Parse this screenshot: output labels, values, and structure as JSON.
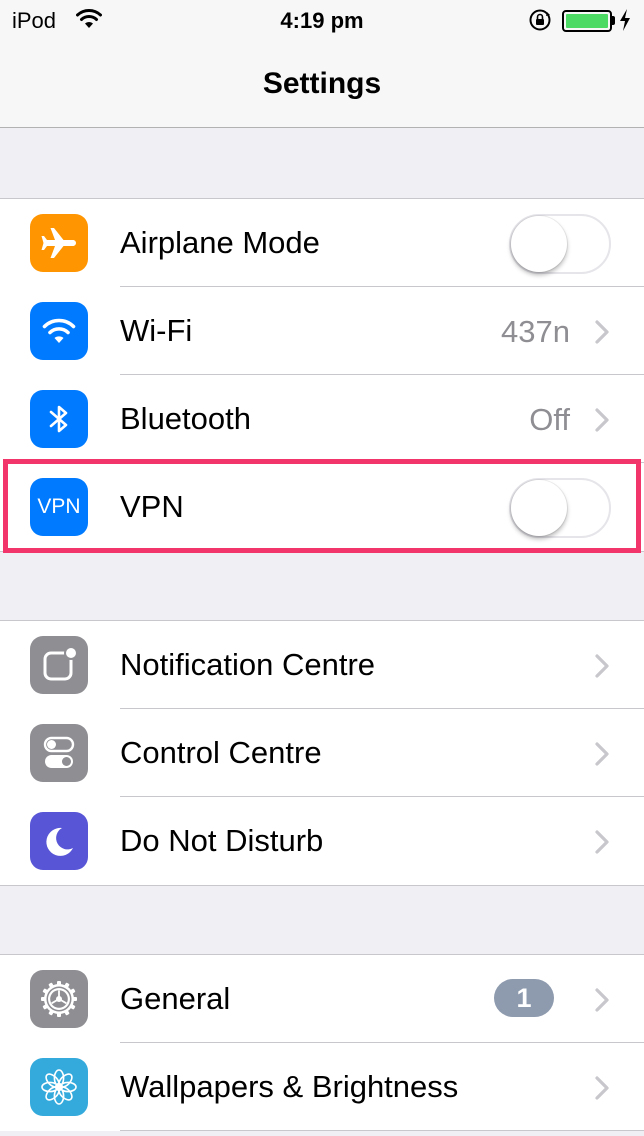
{
  "status_bar": {
    "carrier": "iPod",
    "time": "4:19 pm",
    "wifi_icon": "wifi-icon",
    "lock_icon": "rotation-lock-icon",
    "battery_level": 1.0,
    "battery_color": "#4cd964",
    "charging_icon": "bolt-icon"
  },
  "nav": {
    "title": "Settings"
  },
  "groups": [
    {
      "rows": [
        {
          "label": "Airplane Mode",
          "icon": "airplane-icon",
          "icon_color": "#ff9500",
          "control": "toggle",
          "toggle_on": false
        },
        {
          "label": "Wi-Fi",
          "icon": "wifi-icon",
          "icon_color": "#007aff",
          "value": "437n",
          "control": "chevron"
        },
        {
          "label": "Bluetooth",
          "icon": "bluetooth-icon",
          "icon_color": "#007aff",
          "value": "Off",
          "control": "chevron"
        },
        {
          "label": "VPN",
          "icon": "vpn-icon",
          "icon_text": "VPN",
          "icon_color": "#007aff",
          "control": "toggle",
          "toggle_on": false,
          "highlighted": true,
          "highlight_color": "#f2366b"
        }
      ]
    },
    {
      "rows": [
        {
          "label": "Notification Centre",
          "icon": "notification-centre-icon",
          "icon_color": "#8e8e93",
          "control": "chevron"
        },
        {
          "label": "Control Centre",
          "icon": "control-centre-icon",
          "icon_color": "#8e8e93",
          "control": "chevron"
        },
        {
          "label": "Do Not Disturb",
          "icon": "moon-icon",
          "icon_color": "#5856d6",
          "control": "chevron"
        }
      ]
    },
    {
      "rows": [
        {
          "label": "General",
          "icon": "gear-icon",
          "icon_color": "#8e8e93",
          "badge": "1",
          "control": "chevron"
        },
        {
          "label": "Wallpapers & Brightness",
          "icon": "flower-icon",
          "icon_color": "#34aadc",
          "control": "chevron"
        }
      ]
    }
  ]
}
